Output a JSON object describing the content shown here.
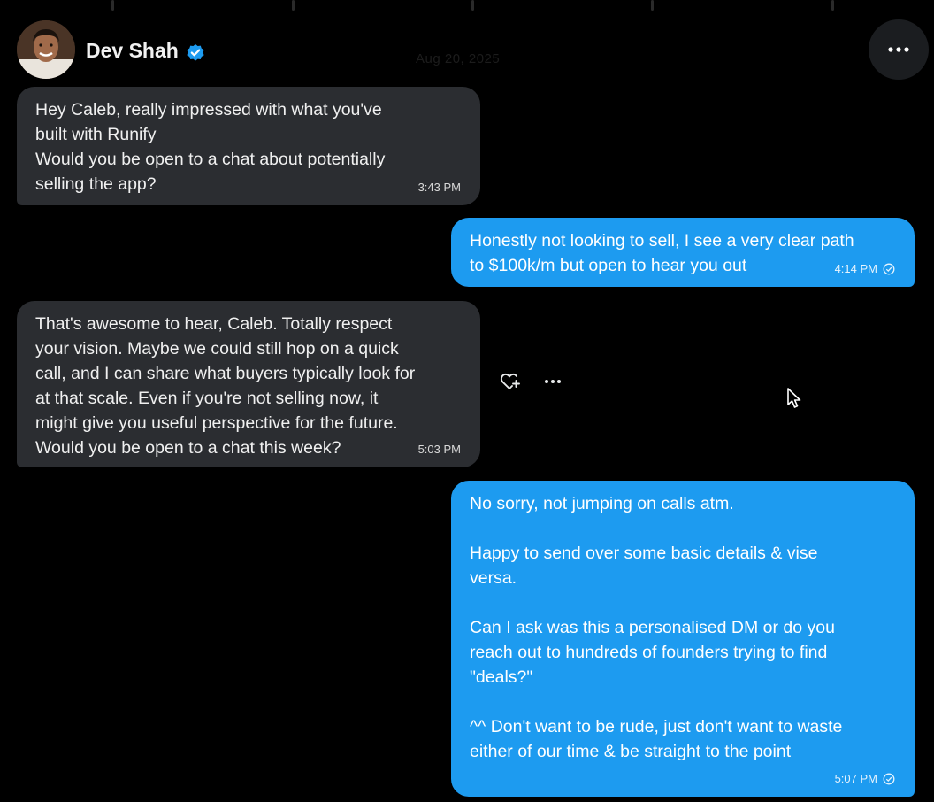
{
  "header": {
    "name": "Dev Shah",
    "date": "Aug 20, 2025"
  },
  "messages": [
    {
      "direction": "incoming",
      "lines": [
        "Hey Caleb, really impressed with what you've",
        "built with Runify",
        "Would you be open to a chat about potentially",
        "selling the app?"
      ],
      "time": "3:43 PM"
    },
    {
      "direction": "outgoing",
      "lines": [
        "Honestly not looking to sell, I see a very clear path",
        "to $100k/m but open to hear you out"
      ],
      "time": "4:14 PM"
    },
    {
      "direction": "incoming",
      "lines": [
        "That's awesome to hear, Caleb. Totally respect",
        "your vision. Maybe we could still hop on a quick",
        "call, and I can share what buyers typically look for",
        "at that scale. Even if you're not selling now, it",
        "might give you useful perspective for the future.",
        "Would you be open to a chat this week?"
      ],
      "time": "5:03 PM"
    },
    {
      "direction": "outgoing",
      "lines": [
        "No sorry, not jumping on calls atm.",
        "",
        "Happy to send over some basic details & vise",
        "versa.",
        "",
        "Can I ask was this a personalised DM or do you",
        "reach out to hundreds of founders trying to find",
        "\"deals?\"",
        "",
        "^^ Don't want to be rude, just don't want to waste",
        "either of our time & be straight to the point"
      ],
      "time": "5:07 PM"
    }
  ],
  "icons": {
    "verified": "verified-badge-icon",
    "more": "more-horizontal-icon",
    "react": "add-reaction-heart-icon",
    "message_more": "message-more-icon",
    "read": "read-receipt-check-icon",
    "cursor": "mouse-pointer-icon"
  },
  "colors": {
    "background": "#000000",
    "incoming_bubble": "#2b2d31",
    "outgoing_bubble": "#1d9bf0",
    "verified": "#1d9bf0"
  }
}
